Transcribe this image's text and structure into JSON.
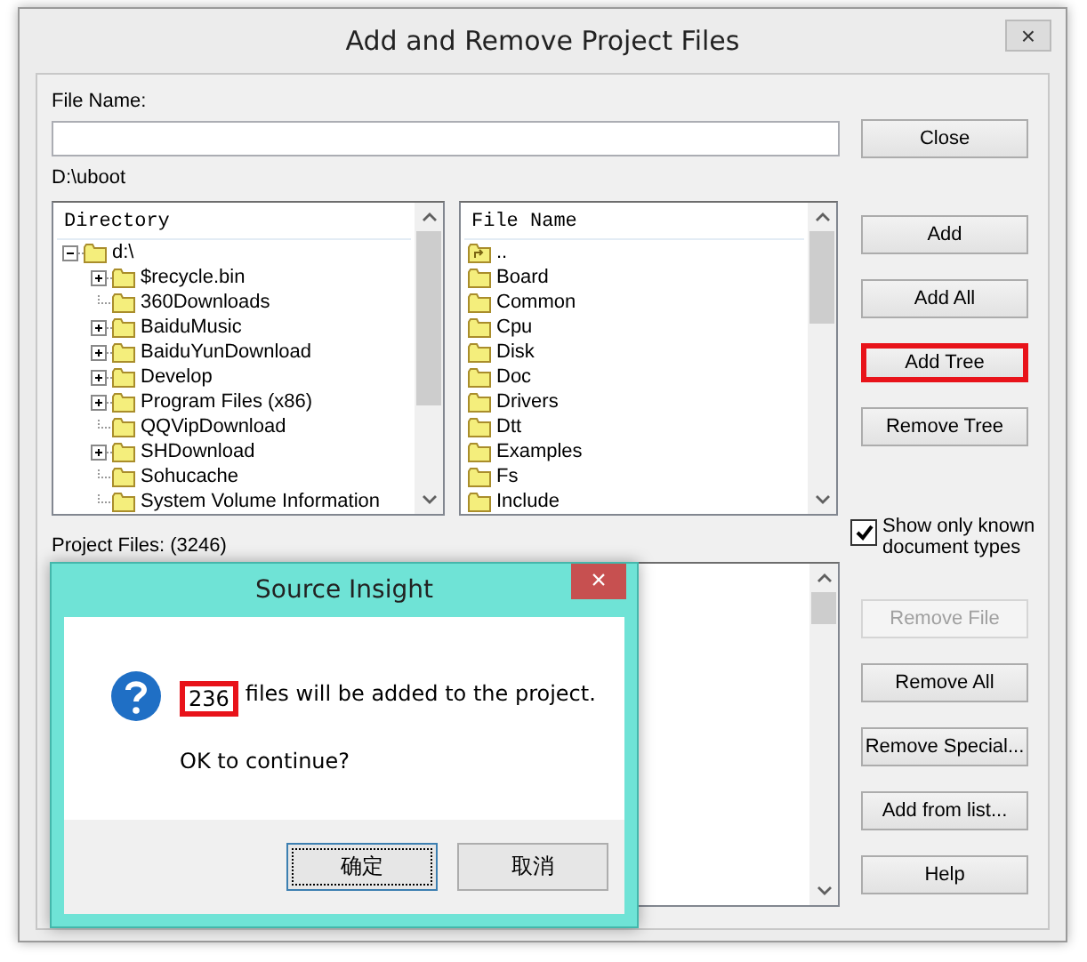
{
  "window": {
    "title": "Add and Remove Project Files",
    "close": "×"
  },
  "file_name": {
    "label": "File Name:"
  },
  "current_path": "D:\\uboot",
  "directory": {
    "header": "Directory",
    "tree": [
      {
        "name": "d:\\",
        "expandable": true,
        "expanded": true,
        "children": [
          {
            "name": "$recycle.bin",
            "expandable": true,
            "expanded": false
          },
          {
            "name": "360Downloads",
            "expandable": false
          },
          {
            "name": "BaiduMusic",
            "expandable": true,
            "expanded": false
          },
          {
            "name": "BaiduYunDownload",
            "expandable": true,
            "expanded": false
          },
          {
            "name": "Develop",
            "expandable": true,
            "expanded": false
          },
          {
            "name": "Program Files (x86)",
            "expandable": true,
            "expanded": false
          },
          {
            "name": "QQVipDownload",
            "expandable": false
          },
          {
            "name": "SHDownload",
            "expandable": true,
            "expanded": false
          },
          {
            "name": "Sohucache",
            "expandable": false
          },
          {
            "name": "System Volume Information",
            "expandable": false
          }
        ]
      }
    ]
  },
  "files": {
    "header": "File Name",
    "items": [
      {
        "name": "..",
        "kind": "parent"
      },
      {
        "name": "Board",
        "kind": "folder"
      },
      {
        "name": "Common",
        "kind": "folder"
      },
      {
        "name": "Cpu",
        "kind": "folder"
      },
      {
        "name": "Disk",
        "kind": "folder"
      },
      {
        "name": "Doc",
        "kind": "folder"
      },
      {
        "name": "Drivers",
        "kind": "folder"
      },
      {
        "name": "Dtt",
        "kind": "folder"
      },
      {
        "name": "Examples",
        "kind": "folder"
      },
      {
        "name": "Fs",
        "kind": "folder"
      },
      {
        "name": "Include",
        "kind": "folder"
      }
    ]
  },
  "project_files": {
    "label": "Project Files: (3246)"
  },
  "buttons_top": [
    {
      "label": "Close",
      "disabled": false,
      "highlighted": false
    }
  ],
  "buttons_mid": [
    {
      "label": "Add",
      "disabled": false,
      "highlighted": false
    },
    {
      "label": "Add All",
      "disabled": false,
      "highlighted": false
    },
    {
      "label": "Add Tree",
      "disabled": false,
      "highlighted": true
    },
    {
      "label": "Remove Tree",
      "disabled": false,
      "highlighted": false
    }
  ],
  "show_known": {
    "label": "Show only known document types",
    "checked": true
  },
  "buttons_bottom": [
    {
      "label": "Remove File",
      "disabled": true,
      "highlighted": false
    },
    {
      "label": "Remove All",
      "disabled": false,
      "highlighted": false
    },
    {
      "label": "Remove Special...",
      "disabled": false,
      "highlighted": false
    },
    {
      "label": "Add from list...",
      "disabled": false,
      "highlighted": false
    },
    {
      "label": "Help",
      "disabled": false,
      "highlighted": false
    }
  ],
  "dialog": {
    "title": "Source Insight",
    "close": "×",
    "count": "236",
    "count_highlighted": true,
    "message": "files will be added to the project.",
    "question": "OK to continue?",
    "buttons": [
      {
        "label": "确定",
        "focused": true
      },
      {
        "label": "取消",
        "focused": false
      }
    ]
  }
}
